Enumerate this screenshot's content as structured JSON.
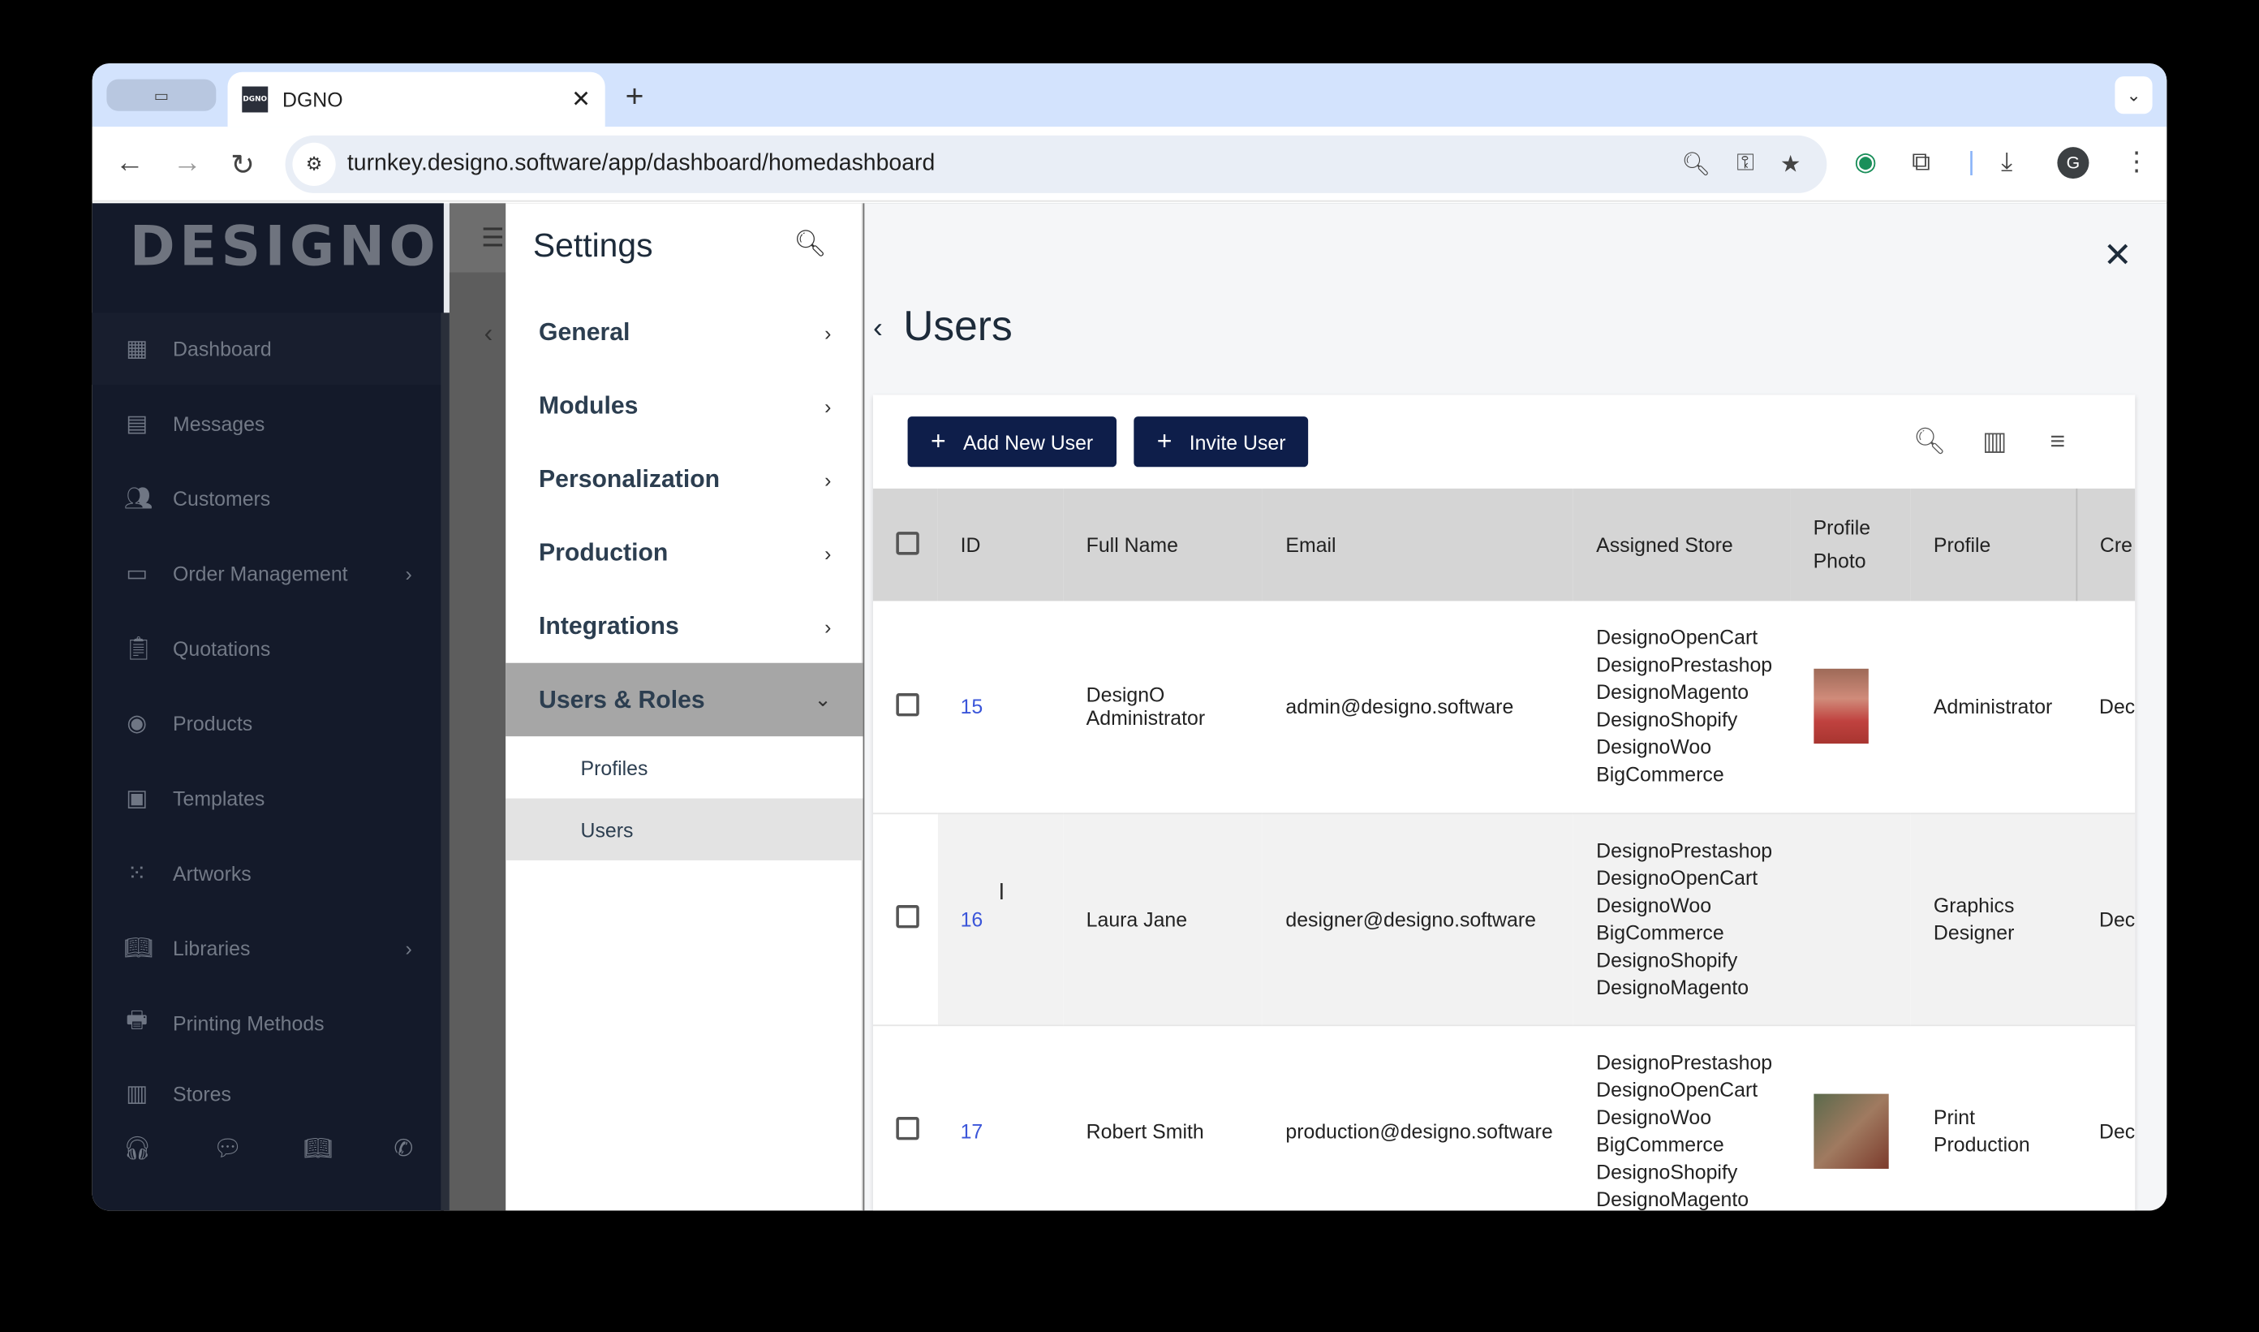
{
  "browser": {
    "tab_title": "DGNO",
    "favicon_text": "DGNO",
    "url": "turnkey.designo.software/app/dashboard/homedashboard",
    "profile_initial": "G"
  },
  "sidebar": {
    "logo": "DESIGNO",
    "items": [
      {
        "label": "Dashboard",
        "icon": "dashboard-icon"
      },
      {
        "label": "Messages",
        "icon": "messages-icon"
      },
      {
        "label": "Customers",
        "icon": "customers-icon"
      },
      {
        "label": "Order Management",
        "icon": "card-icon"
      },
      {
        "label": "Quotations",
        "icon": "clipboard-icon"
      },
      {
        "label": "Products",
        "icon": "product-icon"
      },
      {
        "label": "Templates",
        "icon": "template-icon"
      },
      {
        "label": "Artworks",
        "icon": "artwork-icon"
      },
      {
        "label": "Libraries",
        "icon": "library-icon"
      },
      {
        "label": "Printing Methods",
        "icon": "printer-icon"
      },
      {
        "label": "Stores",
        "icon": "store-icon"
      }
    ]
  },
  "settings": {
    "title": "Settings",
    "items": [
      "General",
      "Modules",
      "Personalization",
      "Production",
      "Integrations",
      "Users & Roles"
    ],
    "sub_items": [
      "Profiles",
      "Users"
    ]
  },
  "users_page": {
    "title": "Users",
    "add_button": "Add New User",
    "invite_button": "Invite User",
    "columns": [
      "ID",
      "Full Name",
      "Email",
      "Assigned Store",
      "Profile Photo",
      "Profile",
      "Cre"
    ],
    "rows": [
      {
        "id": "15",
        "name": "DesignO Administrator",
        "email": "admin@designo.software",
        "stores": [
          "DesignoOpenCart",
          "DesignoPrestashop",
          "DesignoMagento",
          "DesignoShopify",
          "DesignoWoo",
          "BigCommerce"
        ],
        "profile": "Administrator",
        "created": "Dec"
      },
      {
        "id": "16",
        "name": "Laura Jane",
        "email": "designer@designo.software",
        "stores": [
          "DesignoPrestashop",
          "DesignoOpenCart",
          "DesignoWoo",
          "BigCommerce",
          "DesignoShopify",
          "DesignoMagento"
        ],
        "profile": "Graphics Designer",
        "created": "Dec"
      },
      {
        "id": "17",
        "name": "Robert Smith",
        "email": "production@designo.software",
        "stores": [
          "DesignoPrestashop",
          "DesignoOpenCart",
          "DesignoWoo",
          "BigCommerce",
          "DesignoShopify",
          "DesignoMagento"
        ],
        "profile": "Print Production",
        "created": "Dec"
      }
    ]
  }
}
